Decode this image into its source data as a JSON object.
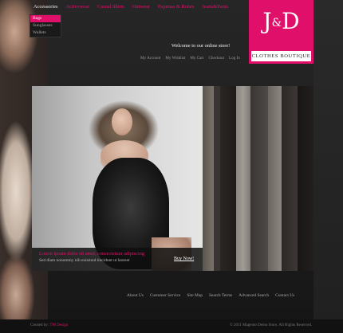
{
  "colors": {
    "accent": "#e0106a",
    "background": "#1e1e1e",
    "logo_bg": "#e0106a"
  },
  "nav": {
    "items": [
      {
        "label": "Accessories",
        "active": true
      },
      {
        "label": "Activewear",
        "active": false
      },
      {
        "label": "Casual Shirts",
        "active": false
      },
      {
        "label": "Outwear",
        "active": false
      },
      {
        "label": "Pajamas & Robes",
        "active": false
      },
      {
        "label": "Jeans&Pants",
        "active": false
      }
    ],
    "submenu": [
      "Bags",
      "Sunglasses",
      "Wallets"
    ]
  },
  "logo": {
    "mark_left": "J",
    "mark_amp": "&",
    "mark_right": "D",
    "subtitle": "CLOTHES BOUTIQUE"
  },
  "header": {
    "welcome": "Welcome to our online store!",
    "account_links": [
      "My Account",
      "My Wishlist",
      "My Cart",
      "Checkout",
      "Log In"
    ]
  },
  "banner": {
    "caption_title": "Lorem ipsum dolor sit amet, consectetuer adipiscing",
    "caption_text": "Sed diam nonummy nib euismod tincidunt ut laoreet",
    "buy_label": "Buy Now!"
  },
  "footer": {
    "links": [
      "About Us",
      "Customer Service",
      "Site Map",
      "Search Terms",
      "Advanced Search",
      "Contact Us"
    ],
    "bottom_left_prefix": "Created by:",
    "bottom_left_brand": "TM Design",
    "bottom_right": "© 2011 Magento Demo Store. All Rights Reserved."
  }
}
